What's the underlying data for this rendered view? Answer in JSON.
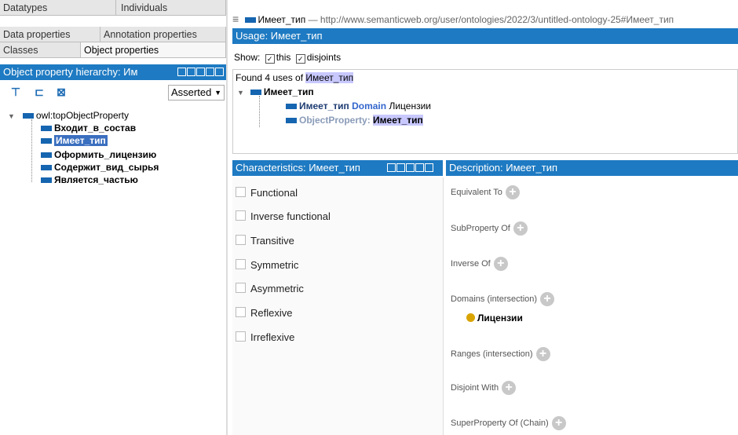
{
  "tabs": {
    "row1": [
      "Datatypes",
      "Individuals"
    ],
    "row2": [
      "Data properties",
      "Annotation properties"
    ],
    "row3": [
      "Classes",
      "Object properties"
    ]
  },
  "hierarchy": {
    "title": "Object property hierarchy: Им",
    "asserted_label": "Asserted",
    "root": "owl:topObjectProperty",
    "items": [
      "Входит_в_состав",
      "Имеет_тип",
      "Оформить_лицензию",
      "Содержит_вид_сырья",
      "Является_частью"
    ]
  },
  "topbar": {
    "menu_icon": "≡",
    "entity": "Имеет_тип",
    "separator": "—",
    "iri": "http://www.semanticweb.org/user/ontologies/2022/3/untitled-ontology-25#Имеет_тип"
  },
  "usage": {
    "title": "Usage: Имеет_тип",
    "show_label": "Show:",
    "this_label": "this",
    "disjoints_label": "disjoints",
    "found_prefix": "Found 4 uses of ",
    "found_entity": "Имеет_тип",
    "tree_root": "Имеет_тип",
    "use1_subject": "Имеет_тип",
    "use1_keyword": "Domain",
    "use1_object": "Лицензии",
    "use2_keyword": "ObjectProperty:",
    "use2_object": "Имеет_тип"
  },
  "characteristics": {
    "title": "Characteristics: Имеет_тип",
    "items": [
      "Functional",
      "Inverse functional",
      "Transitive",
      "Symmetric",
      "Asymmetric",
      "Reflexive",
      "Irreflexive"
    ]
  },
  "description": {
    "title": "Description: Имеет_тип",
    "equivalent_to": "Equivalent To",
    "subproperty_of": "SubProperty Of",
    "inverse_of": "Inverse Of",
    "domains": "Domains (intersection)",
    "domain_value": "Лицензии",
    "ranges": "Ranges (intersection)",
    "disjoint_with": "Disjoint With",
    "superproperty_chain": "SuperProperty Of (Chain)"
  },
  "colors": {
    "header_blue": "#1e7ac2",
    "property_blue": "#1565b0",
    "class_gold": "#d9a400",
    "selection": "#3b6fbf"
  }
}
